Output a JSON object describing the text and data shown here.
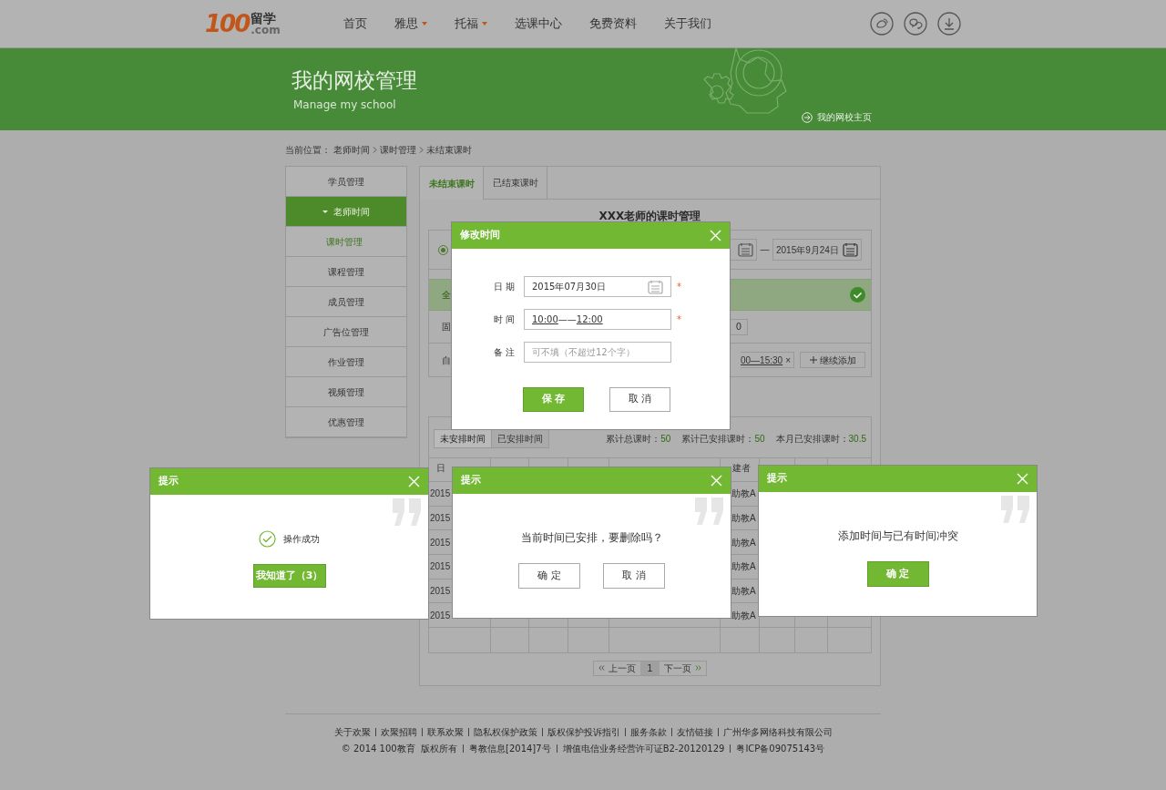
{
  "nav": {
    "logo": {
      "number": "100",
      "cn": "留学",
      "suffix": ".com"
    },
    "items": [
      {
        "label": "首页",
        "dropdown": false
      },
      {
        "label": "雅思",
        "dropdown": true
      },
      {
        "label": "托福",
        "dropdown": true
      },
      {
        "label": "选课中心",
        "dropdown": false
      },
      {
        "label": "免费资料",
        "dropdown": false
      },
      {
        "label": "关于我们",
        "dropdown": false
      }
    ]
  },
  "banner": {
    "title": "我的网校管理",
    "subtitle": "Manage my school",
    "link": "我的网校主页"
  },
  "breadcrumb": {
    "prefix": "当前位置：",
    "items": [
      "老师时间",
      "课时管理",
      "未结束课时"
    ]
  },
  "sidebar": {
    "items": [
      {
        "label": "学员管理",
        "selected": false
      },
      {
        "label": "老师时间",
        "selected": true,
        "expanded": true,
        "children": [
          {
            "label": "课时管理",
            "selected": true
          }
        ]
      },
      {
        "label": "课程管理",
        "selected": false
      },
      {
        "label": "成员管理",
        "selected": false
      },
      {
        "label": "广告位管理",
        "selected": false
      },
      {
        "label": "作业管理",
        "selected": false
      },
      {
        "label": "视频管理",
        "selected": false
      },
      {
        "label": "优惠管理",
        "selected": false
      }
    ]
  },
  "tabs": [
    {
      "label": "未结束课时",
      "selected": true
    },
    {
      "label": "已结束课时",
      "selected": false
    }
  ],
  "heading": "XXX老师的课时管理",
  "filter": {
    "radio_selected": true,
    "dash": "—",
    "end_date": "2015年9月24日"
  },
  "rows": [
    {
      "kind": "all",
      "label": "全",
      "done": true
    },
    {
      "kind": "fixed",
      "label": "固",
      "value": "0"
    },
    {
      "kind": "custom",
      "label": "自",
      "chip": "00—15:30",
      "remove": "×",
      "add": "继续添加"
    }
  ],
  "schedule": {
    "tabs": [
      {
        "label": "未安排时间",
        "selected": true
      },
      {
        "label": "已安排时间",
        "selected": false
      }
    ],
    "stats": [
      {
        "label": "累计总课时：",
        "value": "50"
      },
      {
        "label": "累计已安排课时：",
        "value": "50"
      },
      {
        "label": "本月已安排课时：",
        "value": "30.5"
      }
    ],
    "header_first": "日",
    "header_creator": "建者",
    "rows": [
      {
        "date": "2015",
        "creator": "助教A"
      },
      {
        "date": "2015",
        "creator": "助教A"
      },
      {
        "date": "2015",
        "creator": "助教A"
      },
      {
        "date": "2015",
        "creator": "助教A"
      },
      {
        "date": "2015",
        "creator": "助教A"
      },
      {
        "date": "2015",
        "creator": "助教A"
      }
    ],
    "pagination": {
      "prev": "上一页",
      "page": "1",
      "next": "下一页"
    }
  },
  "footer": {
    "links": [
      "关于欢聚",
      "欢聚招聘",
      "联系欢聚",
      "隐私权保护政策",
      "版权保护投诉指引",
      "服务条款",
      "友情链接",
      "广州华多网络科技有限公司"
    ],
    "info": [
      "© 2014 100教育  版权所有",
      "粤教信息[2014]7号",
      "增值电信业务经营许可证B2-20120129",
      "粤ICP备09075143号"
    ]
  },
  "edit_dialog": {
    "title": "修改时间",
    "fields": [
      {
        "kind": "date",
        "label": "日 期",
        "value": "2015年07月30日",
        "mark": "*"
      },
      {
        "kind": "time",
        "label": "时 间",
        "start": "10:00",
        "sep": "——",
        "end": "12:00",
        "mark": "*"
      },
      {
        "kind": "note",
        "label": "备 注",
        "placeholder": "可不填（不超过12个字）"
      }
    ],
    "buttons": [
      {
        "label": "保 存",
        "primary": true
      },
      {
        "label": "取 消",
        "primary": false
      }
    ]
  },
  "hints": [
    {
      "kind": "success",
      "title": "提示",
      "message": "操作成功",
      "buttons": [
        {
          "label": "我知道了（3）",
          "primary": true
        }
      ]
    },
    {
      "kind": "confirm",
      "title": "提示",
      "message": "当前时间已安排，要删除吗？",
      "buttons": [
        {
          "label": "确 定",
          "primary": false
        },
        {
          "label": "取 消",
          "primary": false
        }
      ]
    },
    {
      "kind": "alert",
      "title": "提示",
      "message": "添加时间与已有时间冲突",
      "buttons": [
        {
          "label": "确 定",
          "primary": true
        }
      ]
    }
  ]
}
